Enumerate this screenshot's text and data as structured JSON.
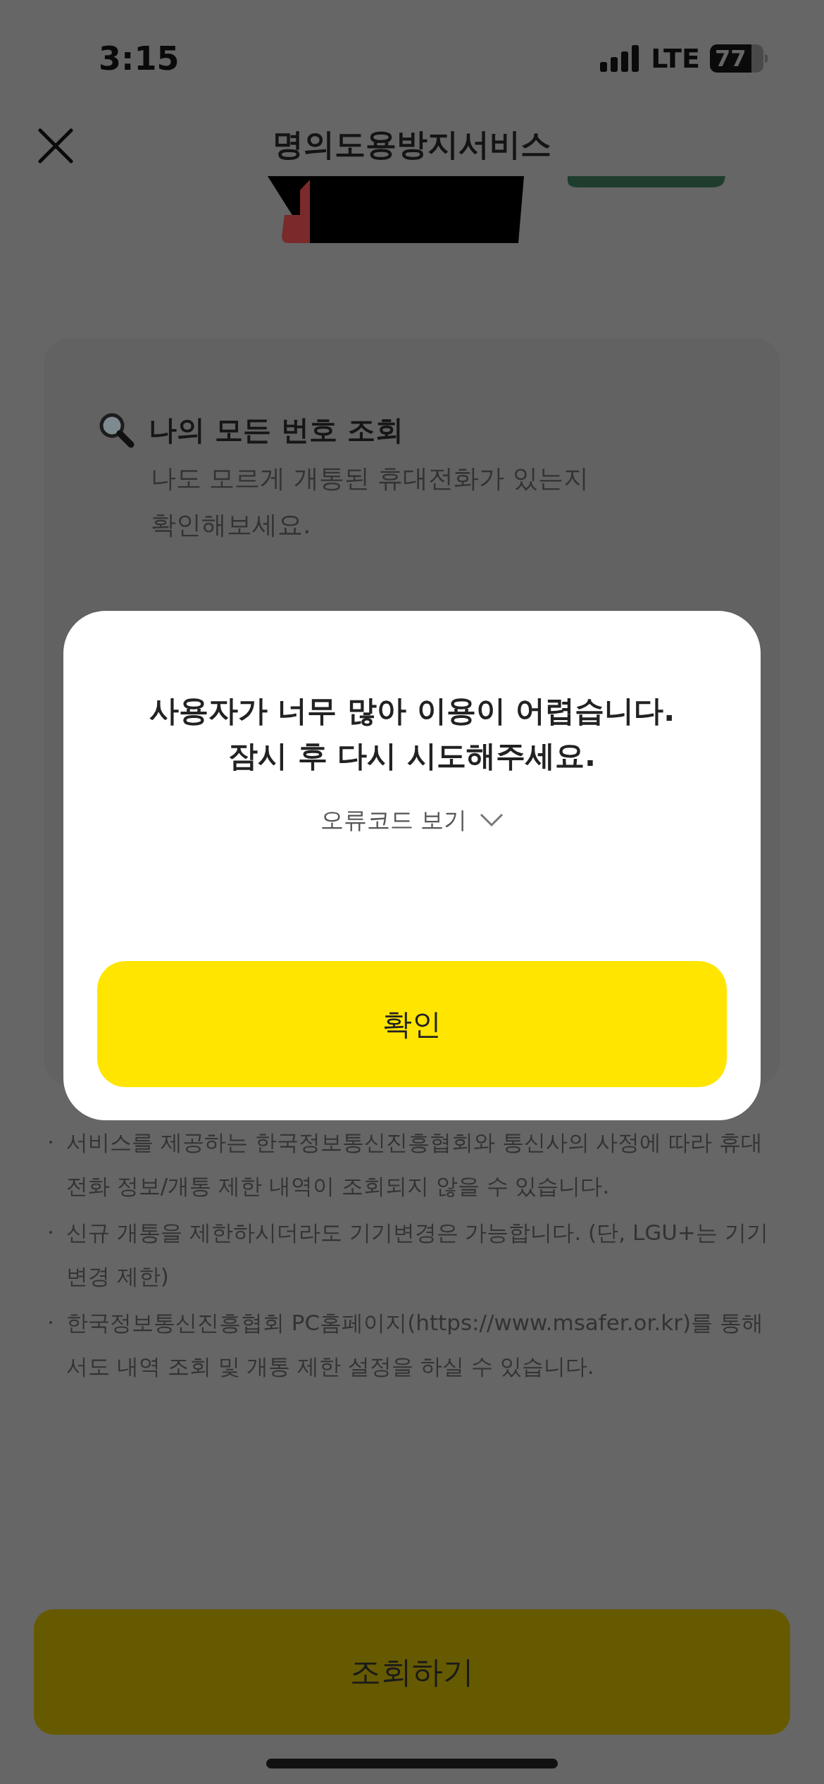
{
  "status_bar": {
    "time": "3:15",
    "network": "LTE",
    "battery": "77"
  },
  "header": {
    "title": "명의도용방지서비스"
  },
  "card": {
    "title": "나의 모든 번호 조회",
    "description_lines": [
      "나도 모르게 개통된 휴대전화가 있는지",
      "확인해보세요."
    ]
  },
  "notes": [
    "서비스를 제공하는 한국정보통신진흥협회와 통신사의 사정에 따라 휴대전화 정보/개통 제한 내역이 조회되지 않을 수 있습니다.",
    "신규 개통을 제한하시더라도 기기변경은 가능합니다. (단, LGU+는 기기변경 제한)",
    "한국정보통신진흥협회 PC홈페이지(https://www.msafer.or.kr)를 통해서도 내역 조회 및 개통 제한 설정을 하실 수 있습니다."
  ],
  "bottom_button": "조회하기",
  "dialog": {
    "message_lines": [
      "사용자가 너무 많아 이용이 어렵습니다.",
      "잠시 후 다시 시도해주세요."
    ],
    "error_code_toggle": {
      "label": "오류코드 보기",
      "expanded": false
    },
    "confirm_button": "확인"
  }
}
